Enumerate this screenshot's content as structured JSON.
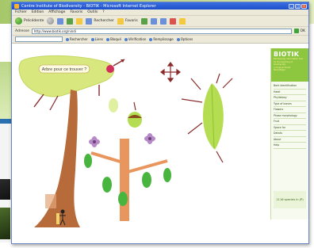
{
  "browser": {
    "title": "Centre Institute of Biodiversity - BIOTIK - Microsoft Internet Explorer",
    "window_buttons": [
      "_",
      "□",
      "×"
    ],
    "menu": [
      "Fichier",
      "Edition",
      "Affichage",
      "Favoris",
      "Outils",
      "?"
    ],
    "toolbar": {
      "back": "Précédente",
      "search": "Rechercher",
      "favorites": "Favoris"
    },
    "address": {
      "label": "Adresse",
      "value": "http://www.biotik.org/nindi",
      "go": "OK"
    },
    "links": [
      "Rechercher",
      "Liens",
      "Bloqué",
      "Vérification",
      "Remplissage",
      "Options"
    ]
  },
  "page": {
    "question_bubble": "Arbre pour ce trouver ?",
    "side_panel": {
      "title": "BIOTIK",
      "description": [
        "Biodiversity information tool",
        "for the teaching of",
        "biodiversity",
        "in tropical forest",
        "Nindi Bilgiri"
      ],
      "items": [
        "Bark identification",
        "Habit",
        "Phyllotaxy",
        "Type of leaves",
        "Flowers",
        "Phase morphology",
        "Fruit",
        "Space for",
        "Details",
        "About",
        "Help"
      ],
      "footer": "1116 species in (P)"
    }
  },
  "colors": {
    "accent": "#8dc63f",
    "trunk": "#b86b3a",
    "leaf": "#6cc04a"
  }
}
